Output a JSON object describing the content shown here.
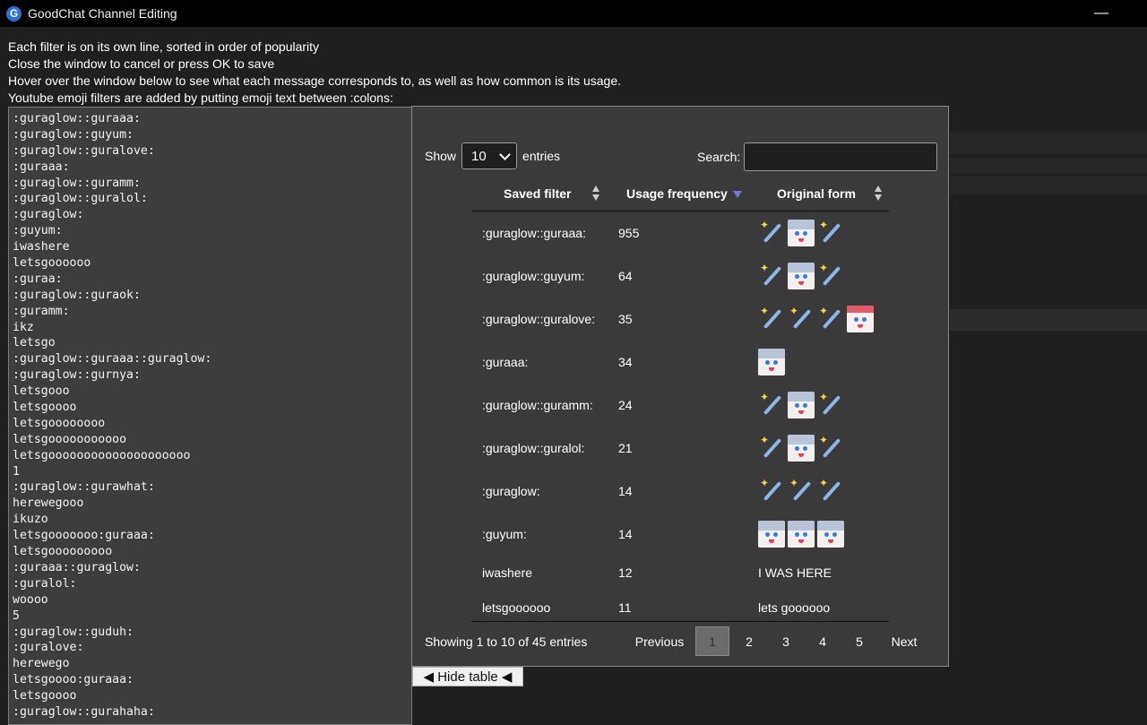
{
  "window": {
    "title": "GoodChat Channel Editing",
    "icon_letter": "G",
    "minimize_glyph": "—",
    "close_glyph": "✕"
  },
  "instructions": [
    "Each filter is on its own line, sorted in order of popularity",
    "Close the window to cancel or press OK to save",
    "Hover over the window below to see what each message corresponds to, as well as how common is its usage.",
    "Youtube emoji filters are added by putting emoji text between :colons:"
  ],
  "filters": [
    ":guraglow::guraaa:",
    ":guraglow::guyum:",
    ":guraglow::guralove:",
    ":guraaa:",
    ":guraglow::guramm:",
    ":guraglow::guralol:",
    ":guraglow:",
    ":guyum:",
    "iwashere",
    "letsgoooooo",
    ":guraa:",
    ":guraglow::guraok:",
    ":guramm:",
    "ikz",
    "letsgo",
    ":guraglow::guraaa::guraglow:",
    ":guraglow::gurnya:",
    "letsgooo",
    "letsgoooo",
    "letsgoooooooo",
    "letsgooooooooooo",
    "letsgoooooooooooooooooooo",
    "1",
    ":guraglow::gurawhat:",
    "herewegooo",
    "ikuzo",
    "letsgooooooo:guraaa:",
    "letsgooooooooo",
    ":guraaa::guraglow:",
    ":guralol:",
    "woooo",
    "5",
    ":guraglow::guduh:",
    ":guralove:",
    "herewego",
    "letsgoooo:guraaa:",
    "letsgoooo",
    ":guraglow::gurahaha:"
  ],
  "table": {
    "show_label": "Show",
    "entries_label": "entries",
    "page_size": "10",
    "search_label": "Search:",
    "search_value": "",
    "columns": [
      "Saved filter",
      "Usage frequency",
      "Original form"
    ],
    "sort_column": "Usage frequency",
    "sort_direction": "descending",
    "rows": [
      {
        "filter": ":guraglow::guraaa:",
        "freq": "955",
        "emotes": [
          "wand-icon",
          "gura-face-icon",
          "wand-icon"
        ],
        "text": ""
      },
      {
        "filter": ":guraglow::guyum:",
        "freq": "64",
        "emotes": [
          "wand-icon",
          "gura-face-icon",
          "wand-icon"
        ],
        "text": ""
      },
      {
        "filter": ":guraglow::guralove:",
        "freq": "35",
        "emotes": [
          "wand-icon",
          "wand-icon",
          "wand-icon",
          "gura-love-icon"
        ],
        "text": ""
      },
      {
        "filter": ":guraaa:",
        "freq": "34",
        "emotes": [
          "gura-face-icon"
        ],
        "text": ""
      },
      {
        "filter": ":guraglow::guramm:",
        "freq": "24",
        "emotes": [
          "wand-icon",
          "gura-face-icon",
          "wand-icon"
        ],
        "text": ""
      },
      {
        "filter": ":guraglow::guralol:",
        "freq": "21",
        "emotes": [
          "wand-icon",
          "gura-face-icon",
          "wand-icon"
        ],
        "text": ""
      },
      {
        "filter": ":guraglow:",
        "freq": "14",
        "emotes": [
          "wand-icon",
          "wand-icon",
          "wand-icon"
        ],
        "text": ""
      },
      {
        "filter": ":guyum:",
        "freq": "14",
        "emotes": [
          "gura-face-icon",
          "gura-face-icon",
          "gura-face-icon"
        ],
        "text": ""
      },
      {
        "filter": "iwashere",
        "freq": "12",
        "emotes": [],
        "text": "I WAS HERE"
      },
      {
        "filter": "letsgoooooo",
        "freq": "11",
        "emotes": [],
        "text": "lets goooooo"
      }
    ],
    "info": "Showing 1 to 10 of 45 entries",
    "pagination": {
      "previous": "Previous",
      "pages": [
        "1",
        "2",
        "3",
        "4",
        "5"
      ],
      "current": "1",
      "next": "Next"
    },
    "accent_color": "#7b74d9"
  },
  "hide_button": "◀ Hide table ◀"
}
